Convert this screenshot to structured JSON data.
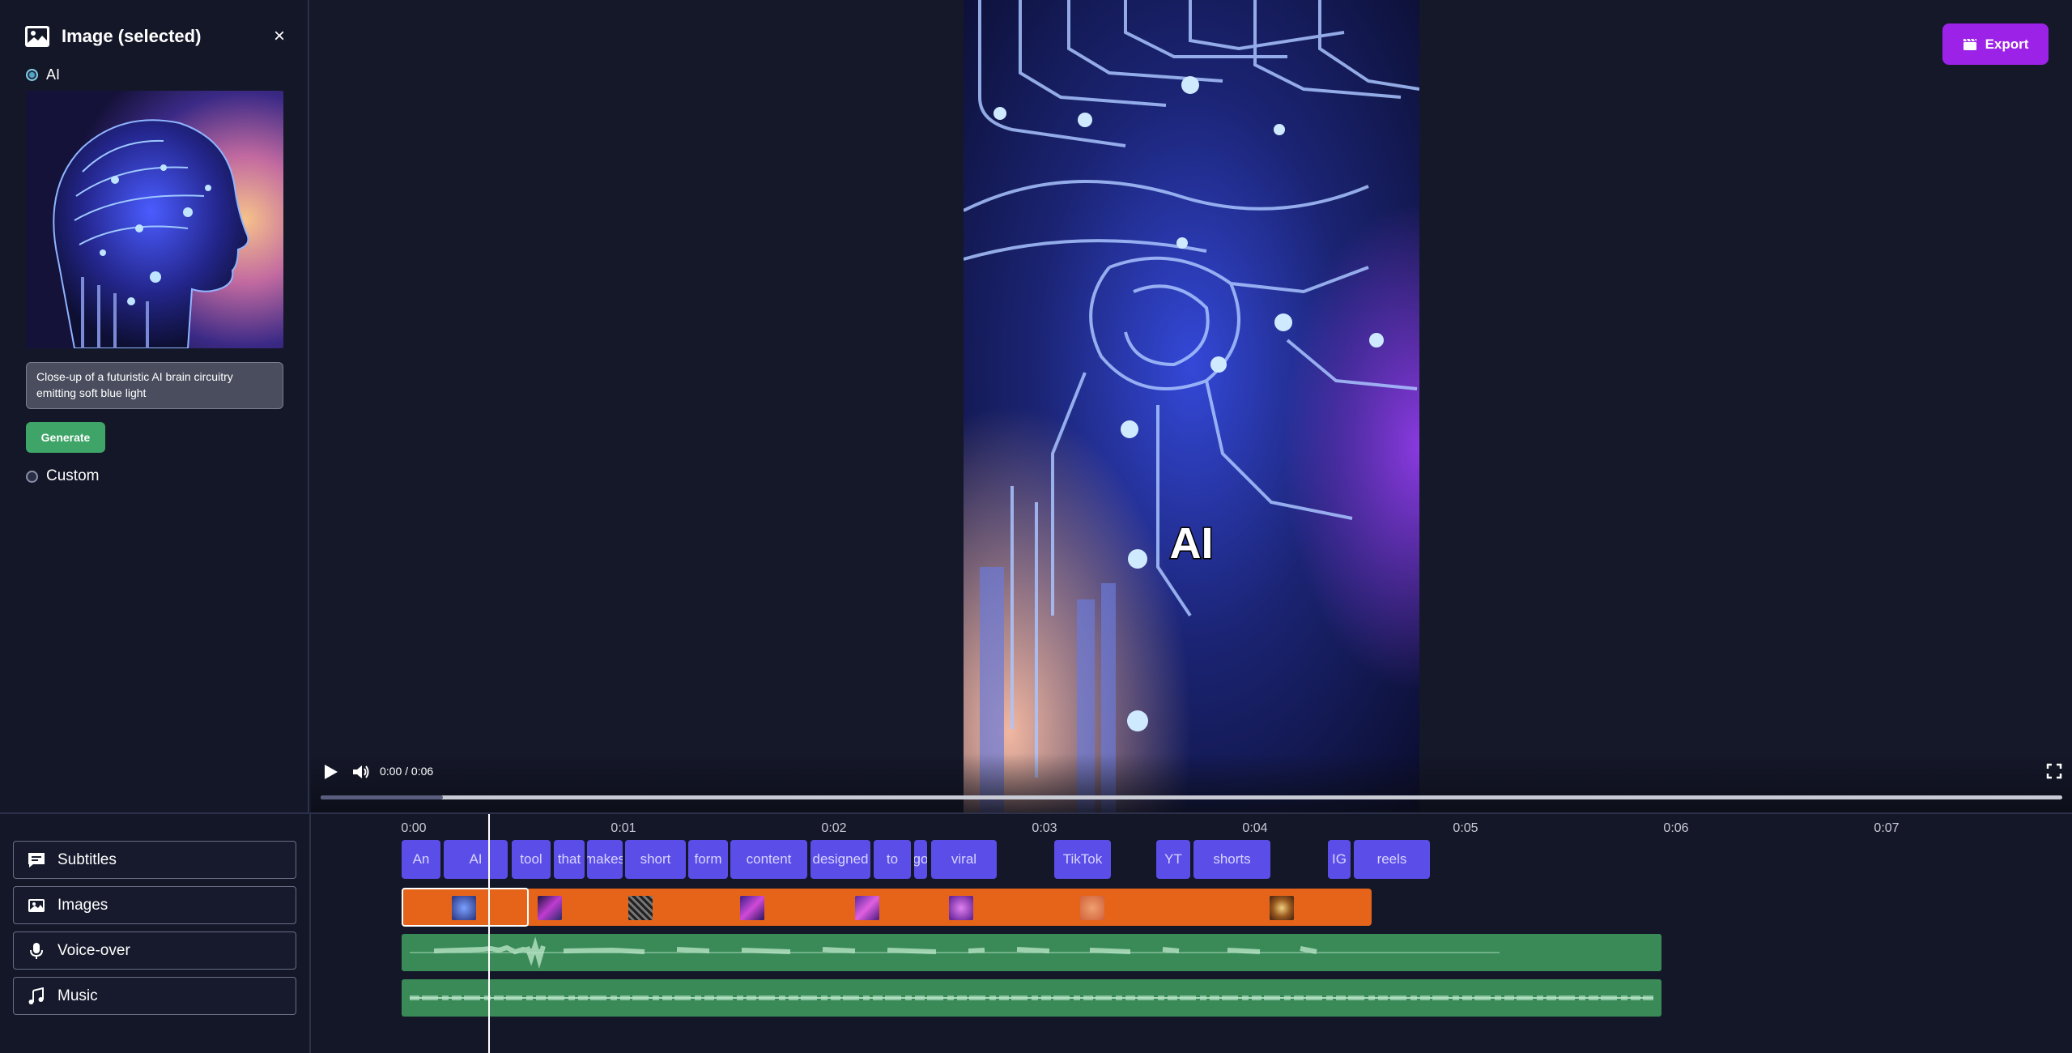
{
  "panel": {
    "title": "Image (selected)",
    "close_symbol": "×",
    "ai_option": "AI",
    "custom_option": "Custom",
    "prompt": "Close-up of a futuristic AI brain circuitry emitting soft blue light",
    "generate_label": "Generate"
  },
  "header": {
    "export_label": "Export"
  },
  "video": {
    "caption": "AI",
    "time": "0:00 / 0:06",
    "progress_fraction": 0.07
  },
  "track_buttons": [
    {
      "label": "Subtitles",
      "icon": "subtitles-icon"
    },
    {
      "label": "Images",
      "icon": "image-icon"
    },
    {
      "label": "Voice-over",
      "icon": "microphone-icon"
    },
    {
      "label": "Music",
      "icon": "music-note-icon"
    }
  ],
  "timeline": {
    "ticks": [
      "0:00",
      "0:01",
      "0:02",
      "0:03",
      "0:04",
      "0:05",
      "0:06",
      "0:07"
    ],
    "subtitle_words": [
      "An",
      "AI",
      "tool",
      "that",
      "makes",
      "short",
      "form",
      "content",
      "designed",
      "to",
      "go",
      "viral",
      "TikTok",
      "YT",
      "shorts",
      "IG",
      "reels"
    ]
  },
  "colors": {
    "accent_export": "#9d22e8",
    "subtitle_chip": "#5b4de8",
    "images_track": "#e5641a",
    "audio_track": "#3a8a58",
    "generate": "#3fa468"
  }
}
